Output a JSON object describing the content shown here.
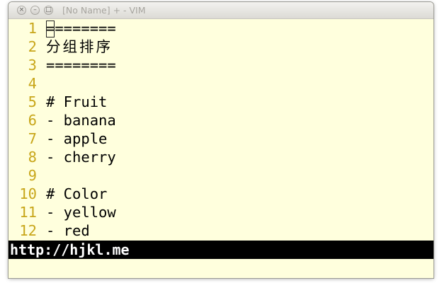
{
  "window": {
    "title": "[No Name] + - VIM",
    "buttons": {
      "close": "×",
      "minimize": "–",
      "maximize": "□"
    }
  },
  "editor": {
    "lines": [
      {
        "num": "1",
        "text": "========"
      },
      {
        "num": "2",
        "text": "分组排序"
      },
      {
        "num": "3",
        "text": "========"
      },
      {
        "num": "4",
        "text": ""
      },
      {
        "num": "5",
        "text": "# Fruit"
      },
      {
        "num": "6",
        "text": "- banana"
      },
      {
        "num": "7",
        "text": "- apple"
      },
      {
        "num": "8",
        "text": "- cherry"
      },
      {
        "num": "9",
        "text": ""
      },
      {
        "num": "10",
        "text": "# Color"
      },
      {
        "num": "11",
        "text": "- yellow"
      },
      {
        "num": "12",
        "text": "- red"
      }
    ]
  },
  "statusbar": {
    "text": "http://hjkl.me"
  },
  "colors": {
    "background": "#ffffdd",
    "line_number": "#c8a61a",
    "statusbar_bg": "#000000",
    "statusbar_fg": "#ffffff"
  }
}
